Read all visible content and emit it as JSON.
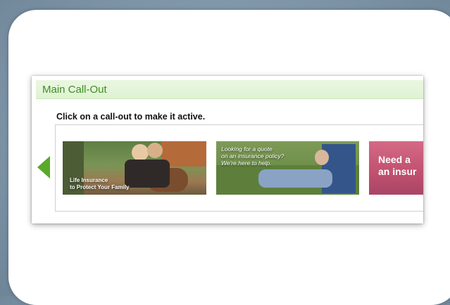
{
  "panel": {
    "title": "Main Call-Out",
    "instructions": "Click on a call-out to make it active."
  },
  "carousel": {
    "prev_icon": "triangle-left-icon",
    "arrow_color": "#5aa92b",
    "tiles": [
      {
        "caption_line1": "Life Insurance",
        "caption_line2": "to Protect Your Family"
      },
      {
        "caption_line1": "Looking for a quote",
        "caption_line2": "on an insurance policy?",
        "caption_line3": "We're here to help."
      },
      {
        "caption_line1": "Need a",
        "caption_line2": "an insur"
      }
    ]
  },
  "colors": {
    "header_green": "#3d8f1f",
    "header_bg": "#e3f4d8"
  }
}
